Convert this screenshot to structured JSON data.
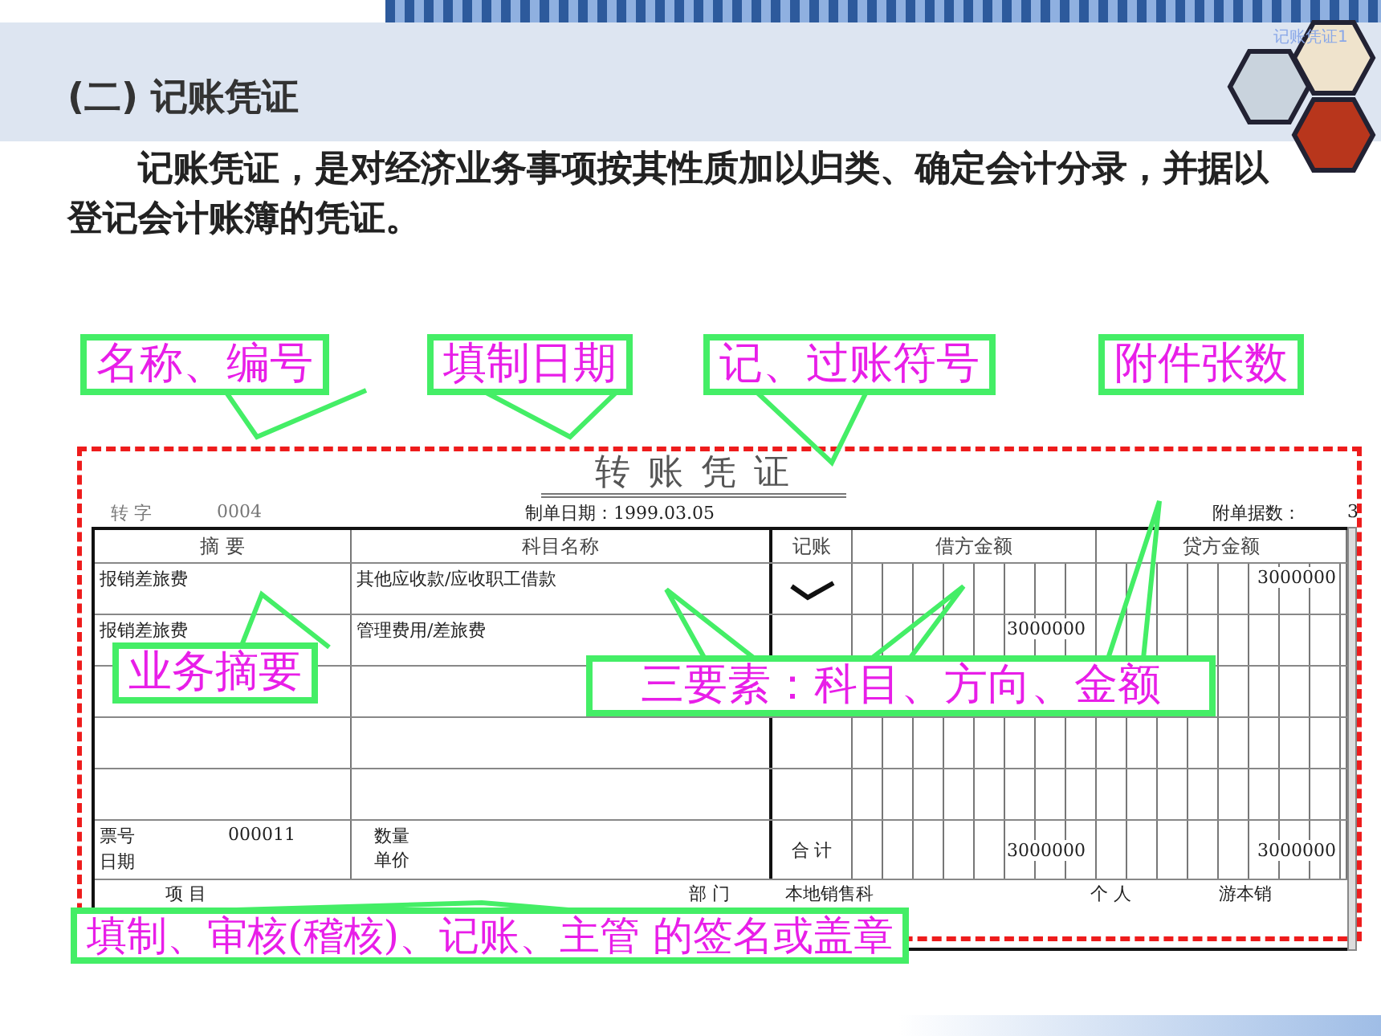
{
  "slide": {
    "corner_label": "记账凭证1",
    "title": "(二) 记账凭证",
    "paragraph": "记账凭证，是对经济业务事项按其性质加以归类、确定会计分录，并据以登记会计账簿的凭证。"
  },
  "top_callouts": [
    {
      "text": "名称、编号"
    },
    {
      "text": "填制日期"
    },
    {
      "text": "记、过账符号"
    },
    {
      "text": "附件张数"
    }
  ],
  "voucher": {
    "title": "转 账 凭 证",
    "type_label": "转 字",
    "number": "0004",
    "date_label": "制单日期：1999.03.05",
    "attachments_label": "附单据数：",
    "attachments": "3",
    "columns": [
      "摘 要",
      "科目名称",
      "记账",
      "借方金额",
      "贷方金额"
    ],
    "rows": [
      {
        "summary": "报销差旅费",
        "account": "其他应收款/应收职工借款",
        "posted": true,
        "credit": "3000000"
      },
      {
        "summary": "报销差旅费",
        "account": "管理费用/差旅费",
        "posted": false,
        "debit": "3000000"
      }
    ],
    "total": {
      "ticket_label": "票号",
      "ticket": "000011",
      "date_label": "日期",
      "qty_label": "数量",
      "price_label": "单价",
      "total_label": "合 计",
      "debit": "3000000",
      "credit": "3000000"
    },
    "footer": [
      "项 目",
      "部 门",
      "本地销售科",
      "个 人",
      "游本销"
    ]
  },
  "inner_callouts": [
    {
      "kind": "summary",
      "text": "业务摘要"
    },
    {
      "kind": "elements",
      "text": "三要素：科目、方向、金额"
    },
    {
      "kind": "signatures",
      "text": "填制、审核(稽核)、记账、主管 的签名或盖章"
    }
  ]
}
